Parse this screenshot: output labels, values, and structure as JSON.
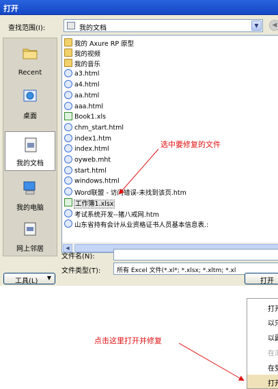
{
  "window": {
    "title": "打开"
  },
  "lookin": {
    "label": "查找范围(I):",
    "value": "我的文档"
  },
  "places": [
    {
      "label": "Recent",
      "icon": "recent-folder-icon"
    },
    {
      "label": "桌面",
      "icon": "desktop-icon"
    },
    {
      "label": "我的文档",
      "icon": "my-documents-icon",
      "selected": true
    },
    {
      "label": "我的电脑",
      "icon": "my-computer-icon"
    },
    {
      "label": "网上邻居",
      "icon": "network-places-icon"
    }
  ],
  "files": [
    {
      "name": "我的 Axure RP 原型",
      "type": "folder"
    },
    {
      "name": "我的视频",
      "type": "folder"
    },
    {
      "name": "我的音乐",
      "type": "folder"
    },
    {
      "name": "a3.html",
      "type": "html"
    },
    {
      "name": "a4.html",
      "type": "html"
    },
    {
      "name": "aa.html",
      "type": "html"
    },
    {
      "name": "aaa.html",
      "type": "html"
    },
    {
      "name": "Book1.xls",
      "type": "xls"
    },
    {
      "name": "chm_start.html",
      "type": "html"
    },
    {
      "name": "index1.htm",
      "type": "html"
    },
    {
      "name": "index.html",
      "type": "html"
    },
    {
      "name": "oyweb.mht",
      "type": "html"
    },
    {
      "name": "start.html",
      "type": "html"
    },
    {
      "name": "windows.html",
      "type": "html"
    },
    {
      "name": "Word联盟 - 访问错误-未找到该页.htm",
      "type": "html"
    },
    {
      "name": "工作簿1.xlsx",
      "type": "xlsx",
      "selected": true
    },
    {
      "name": "考试系统开发--猪八戒网.htm",
      "type": "html"
    },
    {
      "name": "山东省持有会计从业资格证书人员基本信息表.:",
      "type": "html"
    }
  ],
  "filename": {
    "label": "文件名(N):",
    "value": ""
  },
  "filetype": {
    "label": "文件类型(T):",
    "value": "所有 Excel 文件(*.xl*; *.xlsx; *.xltm; *.xl"
  },
  "buttons": {
    "tools": "工具(L)",
    "open": "打开"
  },
  "open_menu": [
    {
      "label": "打开",
      "enabled": true
    },
    {
      "label": "以只",
      "enabled": true
    },
    {
      "label": "以副",
      "enabled": true
    },
    {
      "label": "在浏",
      "enabled": false
    },
    {
      "label": "在受",
      "enabled": true
    },
    {
      "label": "打开",
      "enabled": true,
      "highlighted": true
    }
  ],
  "annotations": {
    "select_file": "选中要修复的文件",
    "click_here": "点击这里打开并修复"
  },
  "colors": {
    "annotation": "#e01010",
    "title_bar": "#1546c4"
  }
}
